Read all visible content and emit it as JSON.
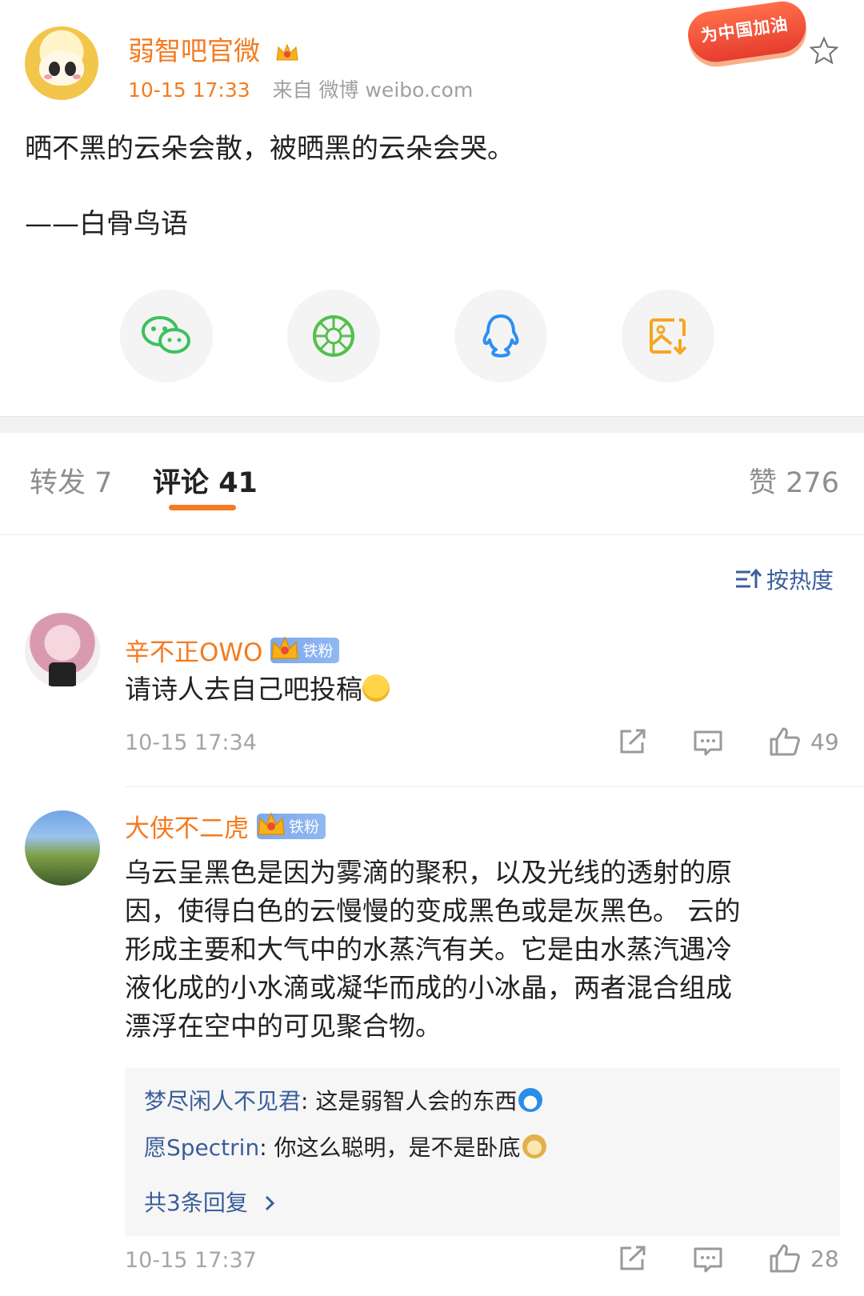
{
  "post": {
    "author": "弱智吧官微",
    "time": "10-15 17:33",
    "source": "来自 微博 weibo.com",
    "badge": "为中国加油",
    "lines": [
      "晒不黑的云朵会散，被晒黑的云朵会哭。",
      "——白骨鸟语"
    ]
  },
  "share": {
    "icons": [
      "wechat-icon",
      "moments-icon",
      "qq-icon",
      "save-image-icon"
    ],
    "colors": {
      "wechat": "#3cc15c",
      "moments": "#52c14a",
      "qq": "#2e8ef2",
      "save": "#f5a623"
    }
  },
  "tabs": {
    "repost_label": "转发",
    "repost_count": "7",
    "comment_label": "评论",
    "comment_count": "41",
    "like_label": "赞",
    "like_count": "276"
  },
  "sort": {
    "label": "按热度"
  },
  "comments": [
    {
      "author": "辛不正OWO",
      "badge": "铁粉",
      "text": "请诗人去自己吧投稿",
      "time": "10-15 17:34",
      "likes": "49"
    },
    {
      "author": "大侠不二虎",
      "badge": "铁粉",
      "text_lines": [
        "乌云呈黑色是因为雾滴的聚积，以及光线的透射的原",
        "因，使得白色的云慢慢的变成黑色或是灰黑色。 云的",
        "形成主要和大气中的水蒸汽有关。它是由水蒸汽遇冷",
        "液化成的小水滴或凝华而成的小冰晶，两者混合组成",
        "漂浮在空中的可见聚合物。"
      ],
      "replies": [
        {
          "name": "梦尽闲人不见君",
          "text": ": 这是弱智人会的东西"
        },
        {
          "name": "愿Spectrin",
          "text": ": 你这么聪明，是不是卧底"
        }
      ],
      "more_replies": "共3条回复",
      "time": "10-15 17:37",
      "likes": "28"
    }
  ],
  "theme": {
    "accent": "#f47b20",
    "link": "#3a5e9a"
  }
}
